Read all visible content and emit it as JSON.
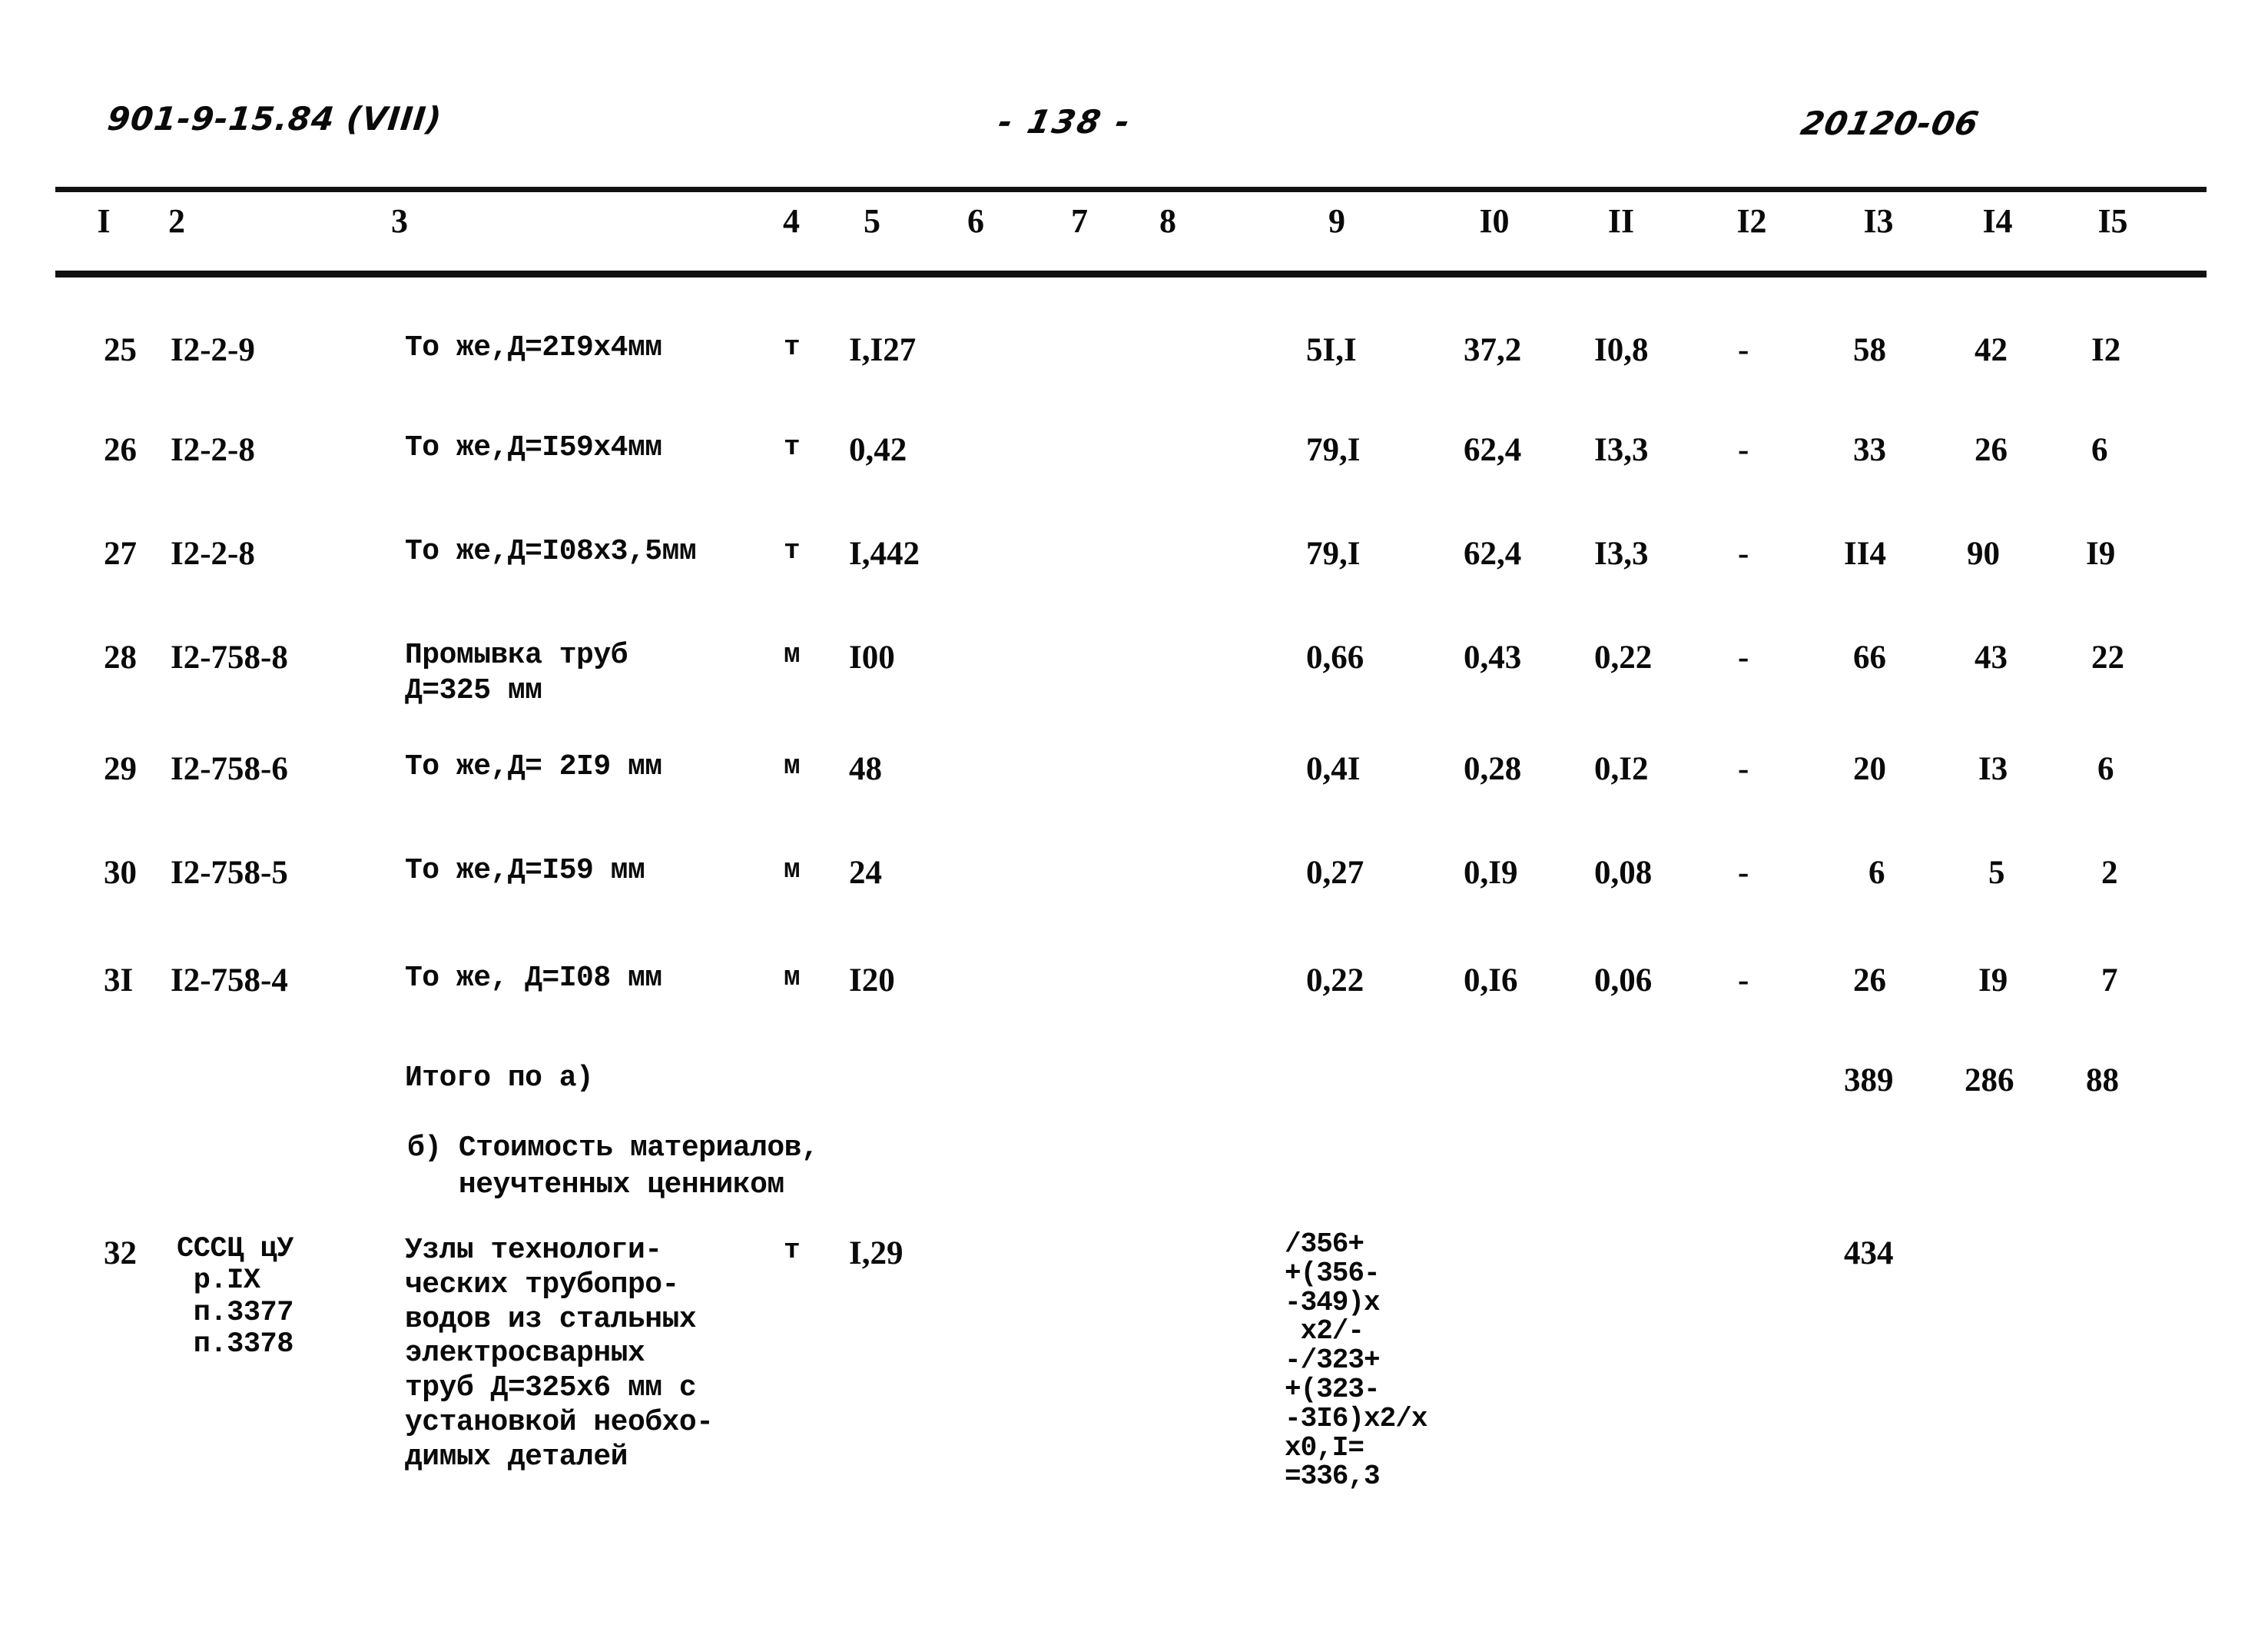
{
  "header": {
    "doc_code": "901-9-15.84 (VIII)",
    "page_number": "- 138 -",
    "sheet_code": "20120-06"
  },
  "table": {
    "column_headers": [
      "I",
      "2",
      "3",
      "4",
      "5",
      "6",
      "7",
      "8",
      "9",
      "I0",
      "II",
      "I2",
      "I3",
      "I4",
      "I5"
    ],
    "rows": [
      {
        "num": "25",
        "code": "I2-2-9",
        "desc": "То же,Д=2I9х4мм",
        "unit": "т",
        "qty": "I,I27",
        "c9": "5I,I",
        "c10": "37,2",
        "c11": "I0,8",
        "c12": "-",
        "c13": "58",
        "c14": "42",
        "c15": "I2"
      },
      {
        "num": "26",
        "code": "I2-2-8",
        "desc": "То же,Д=I59х4мм",
        "unit": "т",
        "qty": "0,42",
        "c9": "79,I",
        "c10": "62,4",
        "c11": "I3,3",
        "c12": "-",
        "c13": "33",
        "c14": "26",
        "c15": "6"
      },
      {
        "num": "27",
        "code": "I2-2-8",
        "desc": "То же,Д=I08х3,5мм",
        "unit": "т",
        "qty": "I,442",
        "c9": "79,I",
        "c10": "62,4",
        "c11": "I3,3",
        "c12": "-",
        "c13": "II4",
        "c14": "90",
        "c15": "I9"
      },
      {
        "num": "28",
        "code": "I2-758-8",
        "desc": "Промывка труб\nД=325 мм",
        "unit": "м",
        "qty": "I00",
        "c9": "0,66",
        "c10": "0,43",
        "c11": "0,22",
        "c12": "-",
        "c13": "66",
        "c14": "43",
        "c15": "22"
      },
      {
        "num": "29",
        "code": "I2-758-6",
        "desc": "То же,Д= 2I9 мм",
        "unit": "м",
        "qty": "48",
        "c9": "0,4I",
        "c10": "0,28",
        "c11": "0,I2",
        "c12": "-",
        "c13": "20",
        "c14": "I3",
        "c15": "6"
      },
      {
        "num": "30",
        "code": "I2-758-5",
        "desc": "То же,Д=I59 мм",
        "unit": "м",
        "qty": "24",
        "c9": "0,27",
        "c10": "0,I9",
        "c11": "0,08",
        "c12": "-",
        "c13": "6",
        "c14": "5",
        "c15": "2"
      },
      {
        "num": "3I",
        "code": "I2-758-4",
        "desc": "То же, Д=I08 мм",
        "unit": "м",
        "qty": "I20",
        "c9": "0,22",
        "c10": "0,I6",
        "c11": "0,06",
        "c12": "-",
        "c13": "26",
        "c14": "I9",
        "c15": "7"
      }
    ],
    "subtotal": {
      "label": "Итого по а)",
      "c13": "389",
      "c14": "286",
      "c15": "88"
    },
    "section_b": {
      "heading": "б) Стоимость материалов,\n   неучтенных ценником"
    },
    "row_32": {
      "num": "32",
      "code_lines": "СССЦ цУ\n р.IX\n п.3377\n п.3378",
      "desc": "Узлы технологи-\nческих трубопро-\nводов из стальных\nэлектросварных\nтруб Д=325х6 мм с\nустановкой необхо-\nдимых деталей",
      "unit": "т",
      "qty": "I,29",
      "formula": "/356+\n+(356-\n-349)х\n х2/-\n-/323+\n+(323-\n-3I6)х2/х\nх0,I=\n=336,3",
      "c13": "434"
    }
  }
}
